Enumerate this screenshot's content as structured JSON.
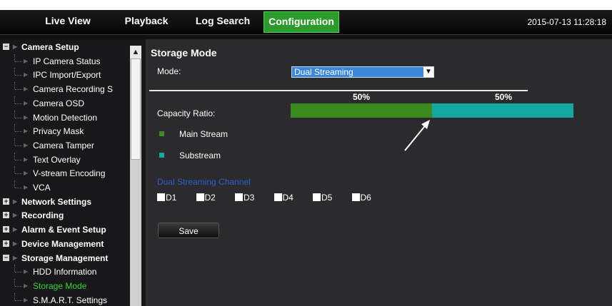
{
  "nav": {
    "tabs": [
      {
        "label": "Live View",
        "active": false
      },
      {
        "label": "Playback",
        "active": false
      },
      {
        "label": "Log Search",
        "active": false
      },
      {
        "label": "Configuration",
        "active": true
      }
    ],
    "datetime": "2015-07-13 11:28:18"
  },
  "sidebar": {
    "items": [
      {
        "label": "Camera Setup",
        "level": 0,
        "expander": "−"
      },
      {
        "label": "IP Camera Status",
        "level": 1
      },
      {
        "label": "IPC Import/Export",
        "level": 1
      },
      {
        "label": "Camera Recording S",
        "level": 1
      },
      {
        "label": "Camera OSD",
        "level": 1
      },
      {
        "label": "Motion Detection",
        "level": 1
      },
      {
        "label": "Privacy Mask",
        "level": 1
      },
      {
        "label": "Camera Tamper",
        "level": 1
      },
      {
        "label": "Text Overlay",
        "level": 1
      },
      {
        "label": "V-stream Encoding",
        "level": 1
      },
      {
        "label": "VCA",
        "level": 1
      },
      {
        "label": "Network Settings",
        "level": 0,
        "expander": "+"
      },
      {
        "label": "Recording",
        "level": 0,
        "expander": "+"
      },
      {
        "label": "Alarm & Event Setup",
        "level": 0,
        "expander": "+"
      },
      {
        "label": "Device Management",
        "level": 0,
        "expander": "+"
      },
      {
        "label": "Storage Management",
        "level": 0,
        "expander": "−"
      },
      {
        "label": "HDD Information",
        "level": 1
      },
      {
        "label": "Storage Mode",
        "level": 1,
        "selected": true
      },
      {
        "label": "S.M.A.R.T. Settings",
        "level": 1
      }
    ],
    "scroll_up_icon": "chevron-up-icon"
  },
  "main": {
    "title": "Storage Mode",
    "mode_label": "Mode:",
    "mode_value": "Dual Streaming",
    "capacity_label": "Capacity Ratio:",
    "capacity": [
      {
        "percent_label": "50%",
        "value": 0.5,
        "color": "#3a8a1f"
      },
      {
        "percent_label": "50%",
        "value": 0.5,
        "color": "#15a8a0"
      }
    ],
    "legend": [
      {
        "label": "Main Stream",
        "color": "#3a8a1f"
      },
      {
        "label": "Substream",
        "color": "#15a8a0"
      }
    ],
    "dual_channel_title": "Dual Streaming Channel",
    "channels": [
      "D1",
      "D2",
      "D3",
      "D4",
      "D5",
      "D6"
    ],
    "save_label": "Save"
  },
  "colors": {
    "active_tab": "#2c9a2c",
    "selected_item": "#37d437",
    "select_bg": "#3a86d8"
  }
}
